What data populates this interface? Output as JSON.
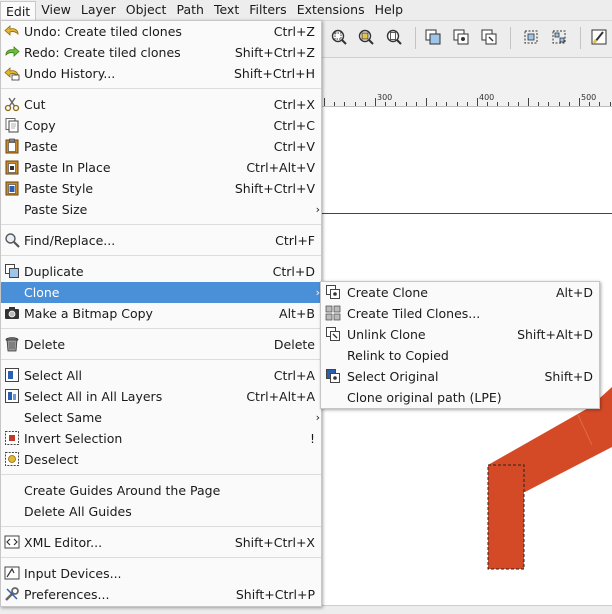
{
  "menubar": {
    "items": [
      "Edit",
      "View",
      "Layer",
      "Object",
      "Path",
      "Text",
      "Filters",
      "Extensions",
      "Help"
    ]
  },
  "ruler": {
    "labels": [
      "300",
      "400",
      "500"
    ]
  },
  "edit_menu": {
    "undo": {
      "label": "Undo: Create tiled clones",
      "shortcut": "Ctrl+Z"
    },
    "redo": {
      "label": "Redo: Create tiled clones",
      "shortcut": "Shift+Ctrl+Z"
    },
    "undo_history": {
      "label": "Undo History...",
      "shortcut": "Shift+Ctrl+H"
    },
    "cut": {
      "label": "Cut",
      "shortcut": "Ctrl+X"
    },
    "copy": {
      "label": "Copy",
      "shortcut": "Ctrl+C"
    },
    "paste": {
      "label": "Paste",
      "shortcut": "Ctrl+V"
    },
    "paste_in_place": {
      "label": "Paste In Place",
      "shortcut": "Ctrl+Alt+V"
    },
    "paste_style": {
      "label": "Paste Style",
      "shortcut": "Shift+Ctrl+V"
    },
    "paste_size": {
      "label": "Paste Size"
    },
    "find_replace": {
      "label": "Find/Replace...",
      "shortcut": "Ctrl+F"
    },
    "duplicate": {
      "label": "Duplicate",
      "shortcut": "Ctrl+D"
    },
    "clone": {
      "label": "Clone"
    },
    "bitmap_copy": {
      "label": "Make a Bitmap Copy",
      "shortcut": "Alt+B"
    },
    "delete": {
      "label": "Delete",
      "shortcut": "Delete"
    },
    "select_all": {
      "label": "Select All",
      "shortcut": "Ctrl+A"
    },
    "select_all_layers": {
      "label": "Select All in All Layers",
      "shortcut": "Ctrl+Alt+A"
    },
    "select_same": {
      "label": "Select Same"
    },
    "invert_selection": {
      "label": "Invert Selection",
      "shortcut": "!"
    },
    "deselect": {
      "label": "Deselect"
    },
    "guides_page": {
      "label": "Create Guides Around the Page"
    },
    "delete_guides": {
      "label": "Delete All Guides"
    },
    "xml_editor": {
      "label": "XML Editor...",
      "shortcut": "Shift+Ctrl+X"
    },
    "input_devices": {
      "label": "Input Devices..."
    },
    "preferences": {
      "label": "Preferences...",
      "shortcut": "Shift+Ctrl+P"
    }
  },
  "clone_submenu": {
    "create_clone": {
      "label": "Create Clone",
      "shortcut": "Alt+D"
    },
    "create_tiled": {
      "label": "Create Tiled Clones..."
    },
    "unlink_clone": {
      "label": "Unlink Clone",
      "shortcut": "Shift+Alt+D"
    },
    "relink": {
      "label": "Relink to Copied"
    },
    "select_original": {
      "label": "Select Original",
      "shortcut": "Shift+D"
    },
    "clone_path": {
      "label": "Clone original path (LPE)"
    }
  },
  "colors": {
    "highlight": "#4a90d9",
    "shape": "#d44a26"
  },
  "icons": {
    "submenu_arrow": "›"
  }
}
